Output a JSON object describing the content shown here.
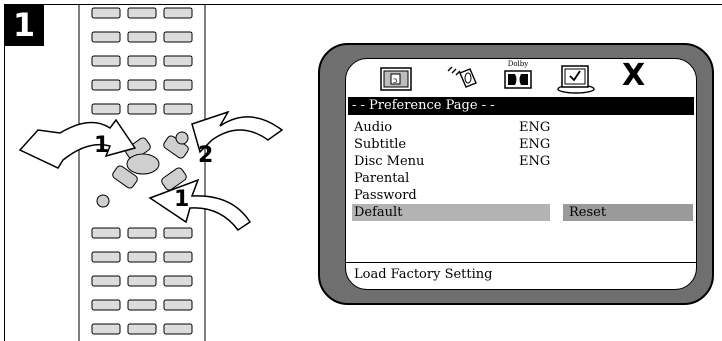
{
  "step": "1",
  "remote": {
    "arrow_labels": [
      "1",
      "2",
      "1"
    ]
  },
  "menu_icons": [
    "language-icon",
    "audio-icon",
    "dolby-icon",
    "preference-icon",
    "exit-icon"
  ],
  "dolby_label": "Dolby",
  "exit_label": "X",
  "menu": {
    "header": "- - Preference Page - -",
    "items": [
      {
        "label": "Audio",
        "value": "ENG"
      },
      {
        "label": "Subtitle",
        "value": "ENG"
      },
      {
        "label": "Disc Menu",
        "value": "ENG"
      },
      {
        "label": "Parental",
        "value": ""
      },
      {
        "label": "Password",
        "value": ""
      },
      {
        "label": "Default",
        "value": ""
      }
    ],
    "selected_option": "Reset",
    "footer": "Load Factory Setting"
  },
  "colors": {
    "tv_bezel": "#6f6f6f",
    "highlight": "#b3b3b3",
    "option_box": "#9a9a9a"
  }
}
